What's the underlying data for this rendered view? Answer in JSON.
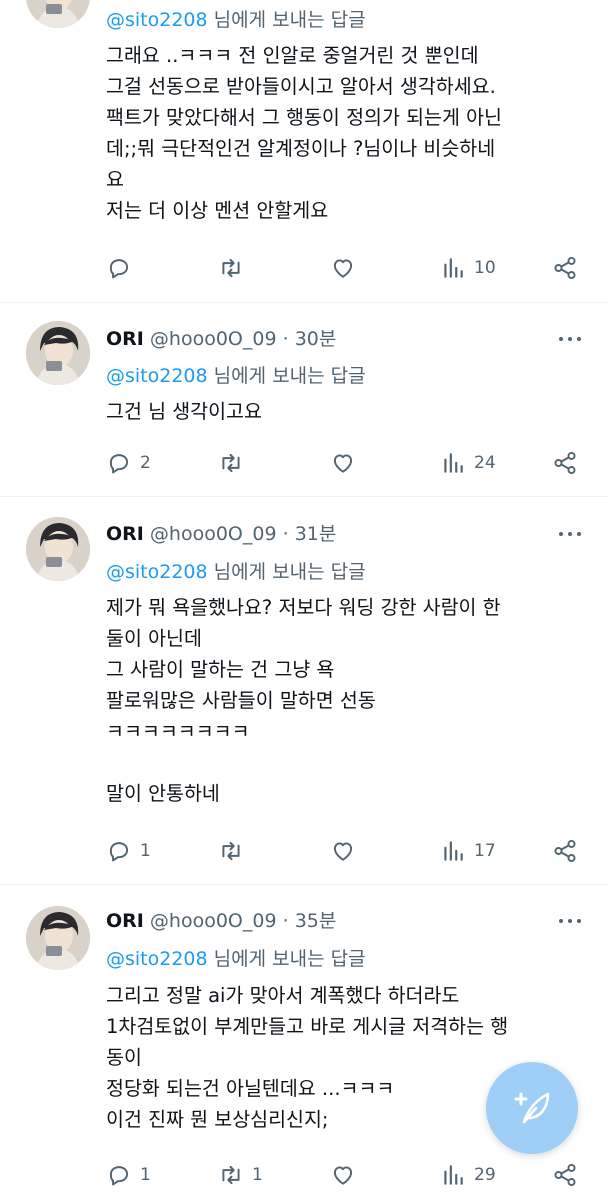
{
  "colors": {
    "accent": "#1d9bf0",
    "muted": "#536471",
    "text": "#0f1419",
    "fab": "#9fcff6"
  },
  "icons": [
    "reply-icon",
    "retweet-icon",
    "like-icon",
    "views-icon",
    "share-icon",
    "more-icon",
    "compose-icon"
  ],
  "tweets": [
    {
      "replying_to": "@sito2208",
      "replying_suffix": " 님에게 보내는 답글",
      "lines": [
        "그래요 ..ㅋㅋㅋ 전 인알로 중얼거린 것 뿐인데",
        "그걸 선동으로 받아들이시고 알아서 생각하세요.",
        "팩트가 맞았다해서 그 행동이 정의가 되는게 아닌",
        "데;;뭐 극단적인건 알계정이나 ?님이나 비슷하네",
        "요",
        "저는 더 이상 멘션 안할게요"
      ],
      "replies": "",
      "retweets": "",
      "views": "10"
    },
    {
      "name": "ORI",
      "handle": "@hooo0O_09",
      "separator": "·",
      "time": "30분",
      "replying_to": "@sito2208",
      "replying_suffix": " 님에게 보내는 답글",
      "lines": [
        "그건 님 생각이고요"
      ],
      "replies": "2",
      "retweets": "",
      "views": "24"
    },
    {
      "name": "ORI",
      "handle": "@hooo0O_09",
      "separator": "·",
      "time": "31분",
      "replying_to": "@sito2208",
      "replying_suffix": " 님에게 보내는 답글",
      "lines": [
        "제가 뭐 욕을했나요? 저보다 워딩 강한 사람이 한",
        "둘이 아닌데",
        "그 사람이 말하는 건 그냥 욕",
        "팔로워많은 사람들이 말하면 선동",
        "ㅋㅋㅋㅋㅋㅋㅋㅋ",
        "",
        "말이 안통하네"
      ],
      "replies": "1",
      "retweets": "",
      "views": "17"
    },
    {
      "name": "ORI",
      "handle": "@hooo0O_09",
      "separator": "·",
      "time": "35분",
      "replying_to": "@sito2208",
      "replying_suffix": " 님에게 보내는 답글",
      "lines": [
        "그리고 정말 ai가 맞아서 계폭했다 하더라도",
        "1차검토없이 부계만들고 바로 게시글 저격하는 행",
        "동이",
        "정당화 되는건 아닐텐데요 ...ㅋㅋㅋ",
        "이건 진짜 뭔 보상심리신지;"
      ],
      "replies": "1",
      "retweets": "1",
      "views": "29"
    }
  ]
}
